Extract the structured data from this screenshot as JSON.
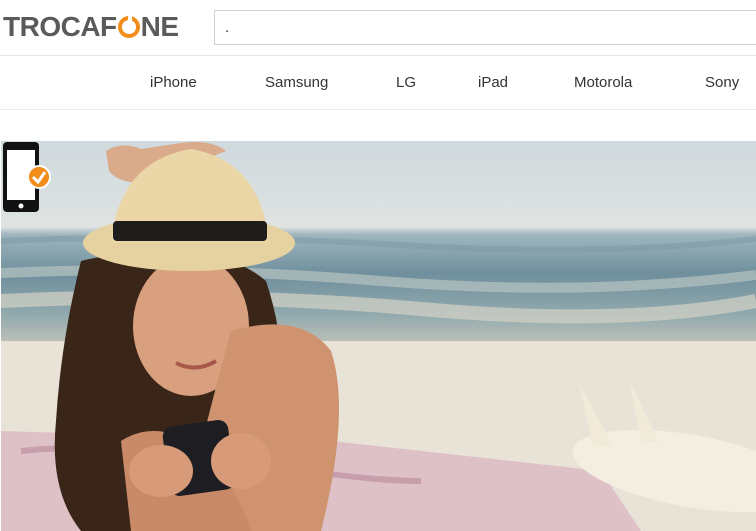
{
  "brand": {
    "logo_prefix": "TROCAF",
    "logo_suffix": "NE",
    "accent_color": "#f28c1a",
    "text_color": "#5a5a5a"
  },
  "search": {
    "value": "."
  },
  "nav": {
    "items": [
      {
        "label": "iPhone"
      },
      {
        "label": "Samsung"
      },
      {
        "label": "LG"
      },
      {
        "label": "iPad"
      },
      {
        "label": "Motorola"
      },
      {
        "label": "Sony"
      }
    ]
  },
  "hero": {
    "image": "woman-on-beach-with-phone",
    "badge_icon": "phone-verified-icon"
  }
}
